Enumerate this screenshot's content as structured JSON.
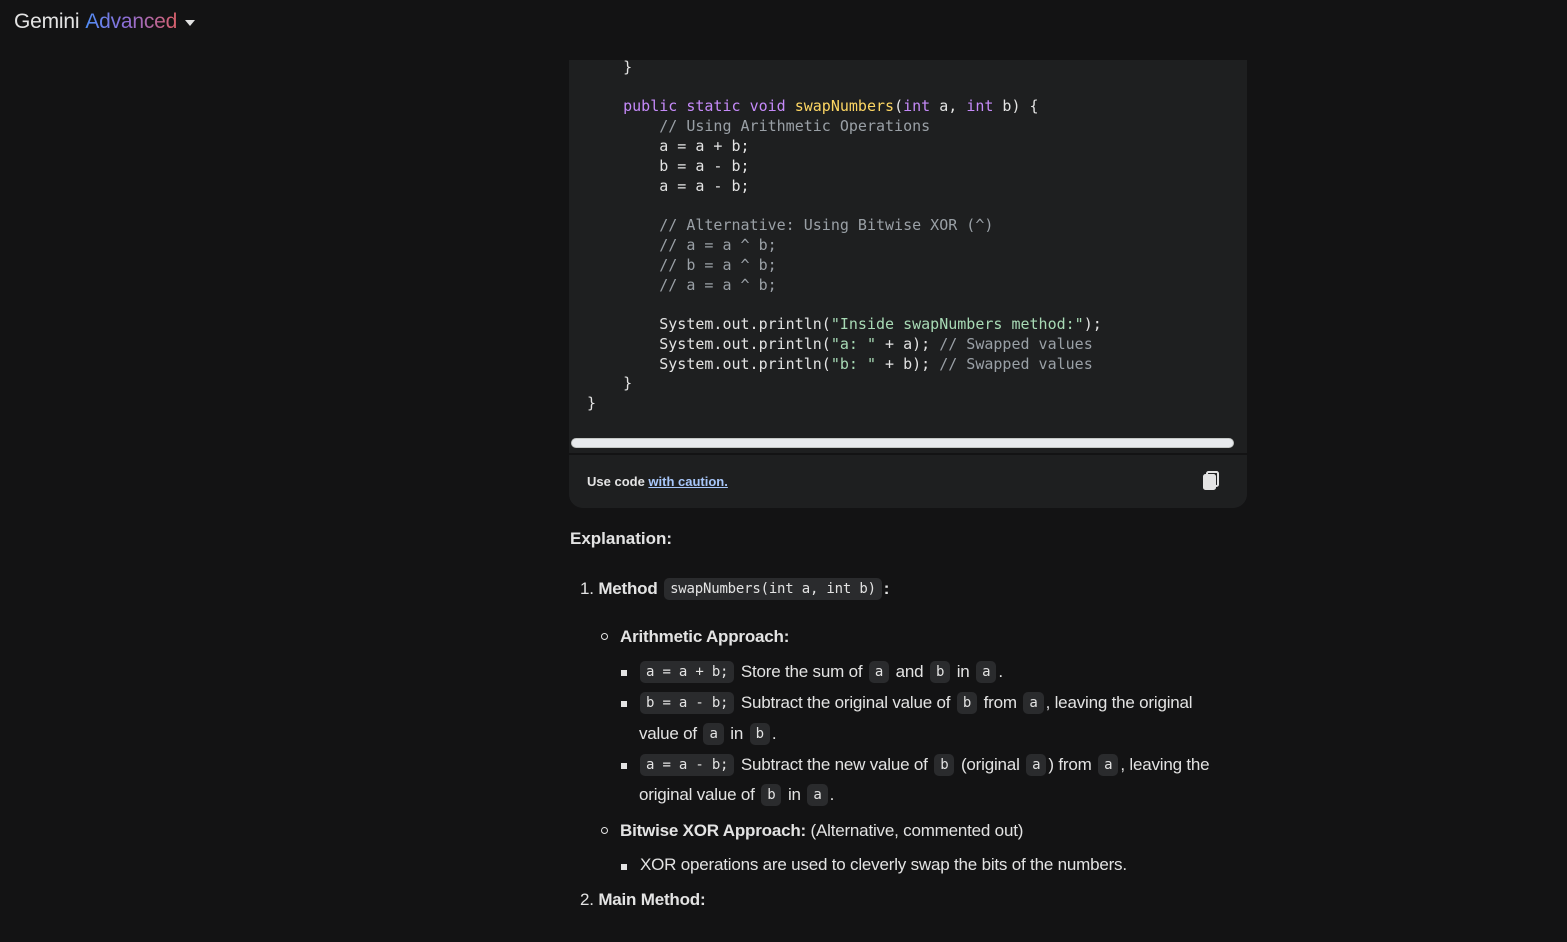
{
  "header": {
    "brand": "Gemini",
    "tier": "Advanced"
  },
  "code": {
    "lines": [
      "    }",
      "",
      "    public static void swapNumbers(int a, int b) {",
      "        // Using Arithmetic Operations",
      "        a = a + b;",
      "        b = a - b;",
      "        a = a - b;",
      "",
      "        // Alternative: Using Bitwise XOR (^)",
      "        // a = a ^ b;",
      "        // b = a ^ b;",
      "        // a = a ^ b;",
      "",
      "        System.out.println(\"Inside swapNumbers method:\");",
      "        System.out.println(\"a: \" + a); // Swapped values",
      "        System.out.println(\"b: \" + b); // Swapped values",
      "    }",
      "}"
    ],
    "footer_prefix": "Use code ",
    "footer_link": "with caution.",
    "copy_icon": "copy-icon"
  },
  "explanation": {
    "heading": "Explanation:",
    "item1_number": "1.",
    "item1_label": "Method",
    "item1_code": "swapNumbers(int a, int b)",
    "item1_colon": ":",
    "arith_label": "Arithmetic Approach:",
    "b1_code": "a = a + b;",
    "b1_t1": "Store the sum of",
    "b1_c1": "a",
    "b1_t2": "and",
    "b1_c2": "b",
    "b1_t3": "in",
    "b1_c3": "a",
    "b1_t4": ".",
    "b2_code": "b = a - b;",
    "b2_t1": "Subtract the original value of",
    "b2_c1": "b",
    "b2_t2": "from",
    "b2_c2": "a",
    "b2_t3": ", leaving the original",
    "b2_l2_t1": "value of",
    "b2_l2_c1": "a",
    "b2_l2_t2": "in",
    "b2_l2_c2": "b",
    "b2_l2_t3": ".",
    "b3_code": "a = a - b;",
    "b3_t1": "Subtract the new value of",
    "b3_c1": "b",
    "b3_t2": "(original",
    "b3_c2": "a",
    "b3_t3": ") from",
    "b3_c3": "a",
    "b3_t4": ", leaving the",
    "b3_l2_t1": "original value of",
    "b3_l2_c1": "b",
    "b3_l2_t2": "in",
    "b3_l2_c2": "a",
    "b3_l2_t3": ".",
    "xor_label": "Bitwise XOR Approach:",
    "xor_note": "(Alternative, commented out)",
    "xor_bullet": "XOR operations are used to cleverly swap the bits of the numbers.",
    "item2_number": "2.",
    "item2_label": "Main Method:"
  }
}
